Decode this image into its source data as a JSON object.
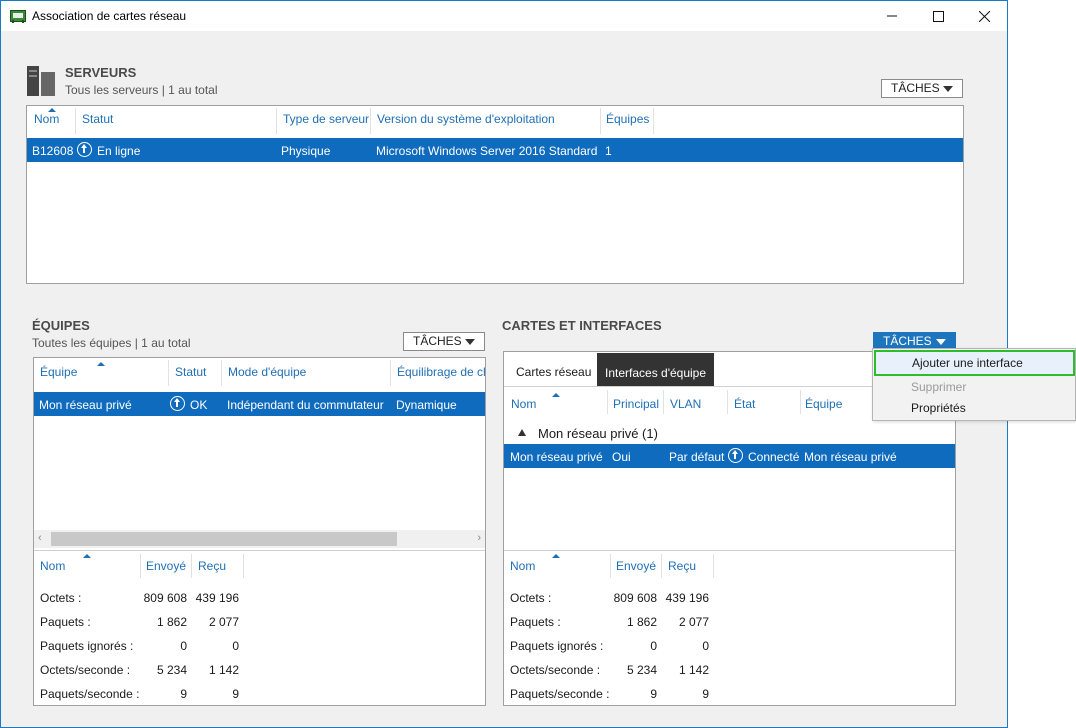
{
  "window": {
    "title": "Association de cartes réseau",
    "icon": "nic-teaming-icon"
  },
  "servers": {
    "title": "SERVEURS",
    "subtitle": "Tous les serveurs | 1 au total",
    "tasks_label": "TÂCHES",
    "columns": [
      "Nom",
      "Statut",
      "Type de serveur",
      "Version du système d'exploitation",
      "Équipes"
    ],
    "rows": [
      {
        "name": "B12608",
        "status": "En ligne",
        "type": "Physique",
        "os": "Microsoft Windows Server 2016 Standard",
        "teams": "1"
      }
    ]
  },
  "teams": {
    "title": "ÉQUIPES",
    "subtitle": "Toutes les équipes | 1 au total",
    "tasks_label": "TÂCHES",
    "columns": [
      "Équipe",
      "Statut",
      "Mode d'équipe",
      "Équilibrage de ch"
    ],
    "rows": [
      {
        "team": "Mon réseau privé",
        "status": "OK",
        "mode": "Indépendant du commutateur",
        "balancing": "Dynamique"
      }
    ],
    "stats_columns": [
      "Nom",
      "Envoyé",
      "Reçu"
    ],
    "stats": [
      {
        "label": "Octets :",
        "sent": "809 608",
        "recv": "439 196"
      },
      {
        "label": "Paquets :",
        "sent": "1 862",
        "recv": "2 077"
      },
      {
        "label": "Paquets ignorés :",
        "sent": "0",
        "recv": "0"
      },
      {
        "label": "Octets/seconde :",
        "sent": "5 234",
        "recv": "1 142"
      },
      {
        "label": "Paquets/seconde :",
        "sent": "9",
        "recv": "9"
      }
    ]
  },
  "adapters": {
    "title": "CARTES ET INTERFACES",
    "tasks_label": "TÂCHES",
    "tabs": [
      "Cartes réseau",
      "Interfaces d'équipe"
    ],
    "active_tab": "Interfaces d'équipe",
    "columns": [
      "Nom",
      "Principal",
      "VLAN",
      "État",
      "Équipe"
    ],
    "group_label": "Mon réseau privé (1)",
    "rows": [
      {
        "name": "Mon réseau privé",
        "primary": "Oui",
        "vlan": "Par défaut",
        "state": "Connecté",
        "team": "Mon réseau privé"
      }
    ],
    "stats_columns": [
      "Nom",
      "Envoyé",
      "Reçu"
    ],
    "stats": [
      {
        "label": "Octets :",
        "sent": "809 608",
        "recv": "439 196"
      },
      {
        "label": "Paquets :",
        "sent": "1 862",
        "recv": "2 077"
      },
      {
        "label": "Paquets ignorés :",
        "sent": "0",
        "recv": "0"
      },
      {
        "label": "Octets/seconde :",
        "sent": "5 234",
        "recv": "1 142"
      },
      {
        "label": "Paquets/seconde :",
        "sent": "9",
        "recv": "9"
      }
    ]
  },
  "context_menu": {
    "items": [
      {
        "label": "Ajouter une interface",
        "state": "highlighted"
      },
      {
        "label": "Supprimer",
        "state": "disabled"
      },
      {
        "label": "Propriétés",
        "state": "enabled"
      }
    ]
  },
  "colors": {
    "selection": "#0f6bbd",
    "accent_text": "#1f6fb5",
    "highlight_border": "#2bbd2b"
  }
}
